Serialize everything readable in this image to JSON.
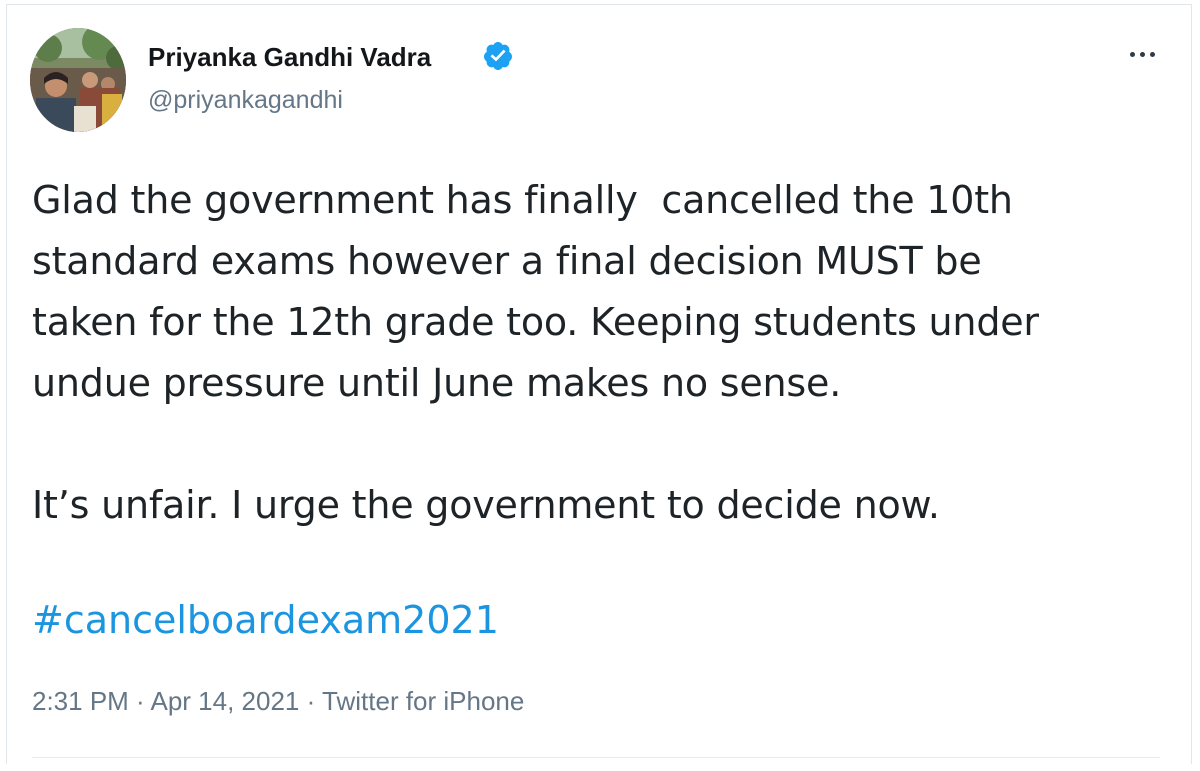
{
  "author": {
    "display_name": "Priyanka Gandhi Vadra",
    "handle": "@priyankagandhi",
    "verified": true,
    "avatar": "profile-photo-crowd"
  },
  "menu": {
    "icon": "more-horizontal-icon"
  },
  "tweet": {
    "lines": [
      "Glad the government has finally  cancelled the 10th",
      "standard exams however a final decision MUST be",
      "taken for the 12th grade too. Keeping students under",
      "undue pressure until June makes no sense."
    ],
    "line2": "It’s unfair. I urge the government to decide now.",
    "hashtag": "#cancelboardexam2021"
  },
  "meta": {
    "time": "2:31 PM",
    "sep1": " · ",
    "date": "Apr 14, 2021",
    "sep2": " · ",
    "source": "Twitter for iPhone"
  },
  "colors": {
    "link": "#1b95e0",
    "secondary_text": "#657786",
    "verified_badge": "#1da1f2"
  }
}
